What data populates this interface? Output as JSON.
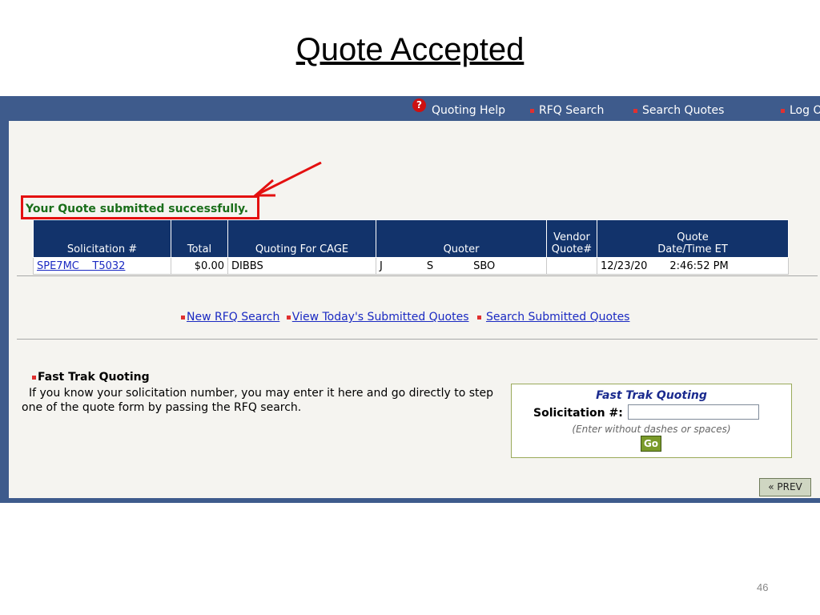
{
  "slide": {
    "title": "Quote Accepted",
    "page_number": "46"
  },
  "nav": {
    "help": "Quoting Help",
    "rfq_search": "RFQ Search",
    "search_quotes": "Search Quotes",
    "logout": "Log O"
  },
  "message": {
    "success": "Your Quote submitted successfully."
  },
  "table": {
    "headers": {
      "solicitation": "Solicitation #",
      "total": "Total",
      "cage": "Quoting For CAGE",
      "quoter": "Quoter",
      "vendor_quote_l1": "Vendor",
      "vendor_quote_l2": "Quote#",
      "date_l1": "Quote",
      "date_l2": "Date/Time ET"
    },
    "row": {
      "solicitation": "SPE7MC    T5032",
      "total": "$0.00",
      "cage": "DIBBS",
      "quoter_first": "J",
      "quoter_middle": "S",
      "quoter_last": "SBO",
      "vendor_quote": "",
      "date": "12/23/20",
      "time": "2:46:52 PM"
    }
  },
  "links": {
    "new_rfq": "New RFQ Search",
    "today_quotes": "View Today's Submitted Quotes",
    "search_submitted": "Search Submitted Quotes"
  },
  "fast_trak": {
    "heading": "Fast Trak Quoting",
    "description": "If you know your solicitation number, you may enter it here and go directly to step one of the quote form by passing the RFQ search.",
    "box_title": "Fast Trak Quoting",
    "solicitation_label": "Solicitation #",
    "input_value": "",
    "hint": "(Enter without dashes or spaces)",
    "go_label": "Go"
  },
  "prev_label": "« PREV"
}
